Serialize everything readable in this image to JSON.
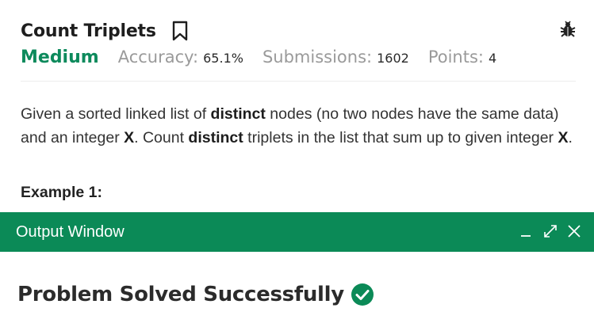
{
  "problem": {
    "title": "Count Triplets",
    "difficulty": "Medium",
    "accuracy_label": "Accuracy:",
    "accuracy_value": "65.1%",
    "submissions_label": "Submissions:",
    "submissions_value": "1602",
    "points_label": "Points:",
    "points_value": "4"
  },
  "description": {
    "p1": "Given a sorted linked list of ",
    "b1": "distinct",
    "p2": " nodes (no two nodes have the same data) and an integer ",
    "b2": "X",
    "p3": ". Count ",
    "b3": "distinct",
    "p4": " triplets in the list that sum up to given integer ",
    "b4": "X",
    "p5": "."
  },
  "example_heading": "Example 1:",
  "output_window": {
    "title": "Output Window",
    "message": "Problem Solved Successfully"
  },
  "icons": {
    "bookmark": "bookmark-icon",
    "bug": "bug-icon",
    "minimize": "minimize-icon",
    "expand": "expand-icon",
    "close": "close-icon",
    "success": "check-circle-icon"
  },
  "colors": {
    "accent": "#0b8a57",
    "difficulty": "#0d8a5c",
    "muted": "#9a9a9a"
  }
}
